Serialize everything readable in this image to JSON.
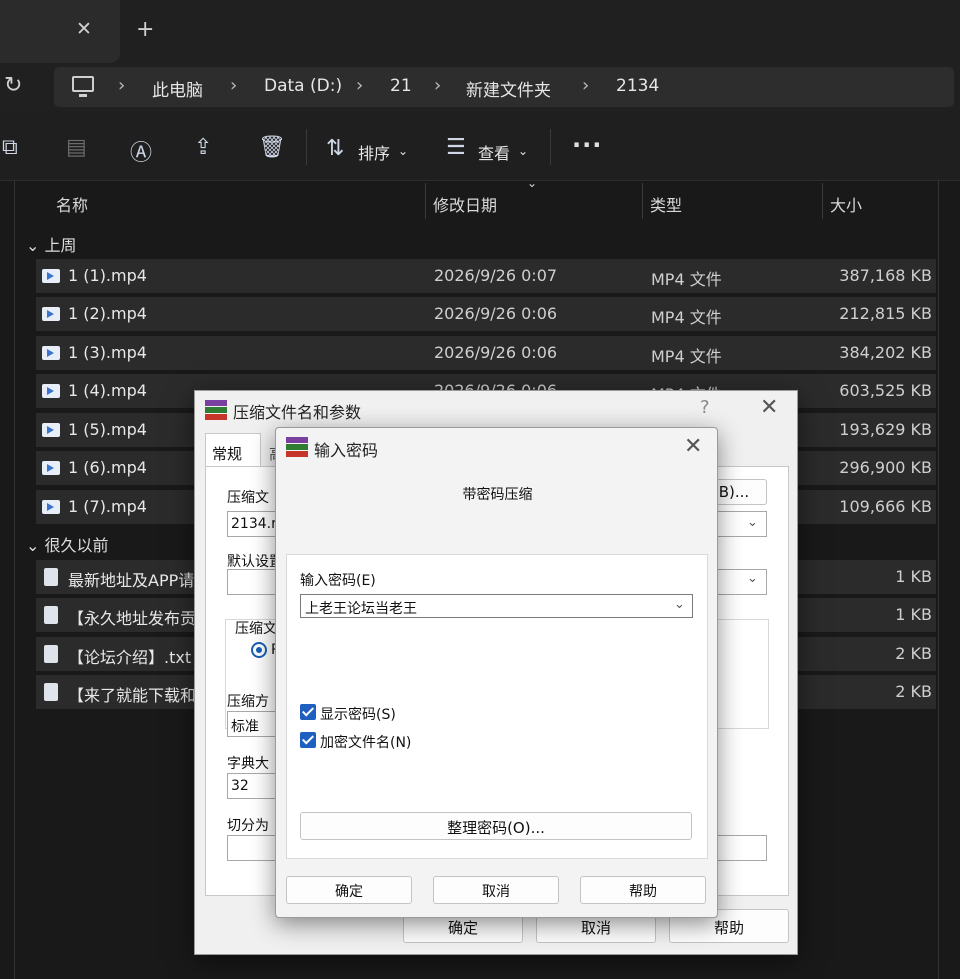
{
  "tabbar": {
    "close_glyph": "✕",
    "new_tab_glyph": "+"
  },
  "address": {
    "breadcrumbs": [
      "此电脑",
      "Data (D:)",
      "21",
      "新建文件夹",
      "2134"
    ]
  },
  "toolbar": {
    "sort_label": "排序",
    "view_label": "查看"
  },
  "columns": {
    "name": "名称",
    "modified": "修改日期",
    "type": "类型",
    "size": "大小"
  },
  "groups": {
    "last_week": "上周",
    "long_ago": "很久以前"
  },
  "files_last_week": [
    {
      "name": "1 (1).mp4",
      "date": "2026/9/26 0:07",
      "type": "MP4 文件",
      "size": "387,168 KB"
    },
    {
      "name": "1 (2).mp4",
      "date": "2026/9/26 0:06",
      "type": "MP4 文件",
      "size": "212,815 KB"
    },
    {
      "name": "1 (3).mp4",
      "date": "2026/9/26 0:06",
      "type": "MP4 文件",
      "size": "384,202 KB"
    },
    {
      "name": "1 (4).mp4",
      "date": "2026/9/26 0:06",
      "type": "MP4 文件",
      "size": "603,525 KB"
    },
    {
      "name": "1 (5).mp4",
      "date": "",
      "type": "",
      "size": "193,629 KB"
    },
    {
      "name": "1 (6).mp4",
      "date": "",
      "type": "",
      "size": "296,900 KB"
    },
    {
      "name": "1 (7).mp4",
      "date": "",
      "type": "",
      "size": "109,666 KB"
    }
  ],
  "files_long_ago": [
    {
      "name": "最新地址及APP请",
      "size": "1 KB"
    },
    {
      "name": "【永久地址发布贡",
      "size": "1 KB"
    },
    {
      "name": "【论坛介绍】.txt",
      "size": "2 KB"
    },
    {
      "name": "【来了就能下载和",
      "size": "2 KB"
    }
  ],
  "archive_dialog": {
    "title": "压缩文件名和参数",
    "help_glyph": "?",
    "close_glyph": "✕",
    "tab_general": "常规",
    "tab_advanced": "高",
    "archive_name_label": "压缩文",
    "archive_name_value": "2134.r",
    "browse_button": "(B)...",
    "profile_label": "默认设置",
    "format_label": "压缩文",
    "radio_label": "R",
    "method_label": "压缩方",
    "method_value": "标准",
    "dict_label": "字典大",
    "dict_value": "32",
    "split_label": "切分为",
    "ok": "确定",
    "cancel": "取消",
    "help": "帮助"
  },
  "password_dialog": {
    "title": "输入密码",
    "close_glyph": "✕",
    "heading": "带密码压缩",
    "password_label": "输入密码(E)",
    "password_value": "上老王论坛当老王",
    "show_password": "显示密码(S)",
    "encrypt_names": "加密文件名(N)",
    "organize": "整理密码(O)...",
    "ok": "确定",
    "cancel": "取消",
    "help": "帮助"
  },
  "colors": {
    "accent": "#1f5fbf",
    "row_bg": "#2b2b2b",
    "dialog_bg": "#f0f0f0"
  }
}
